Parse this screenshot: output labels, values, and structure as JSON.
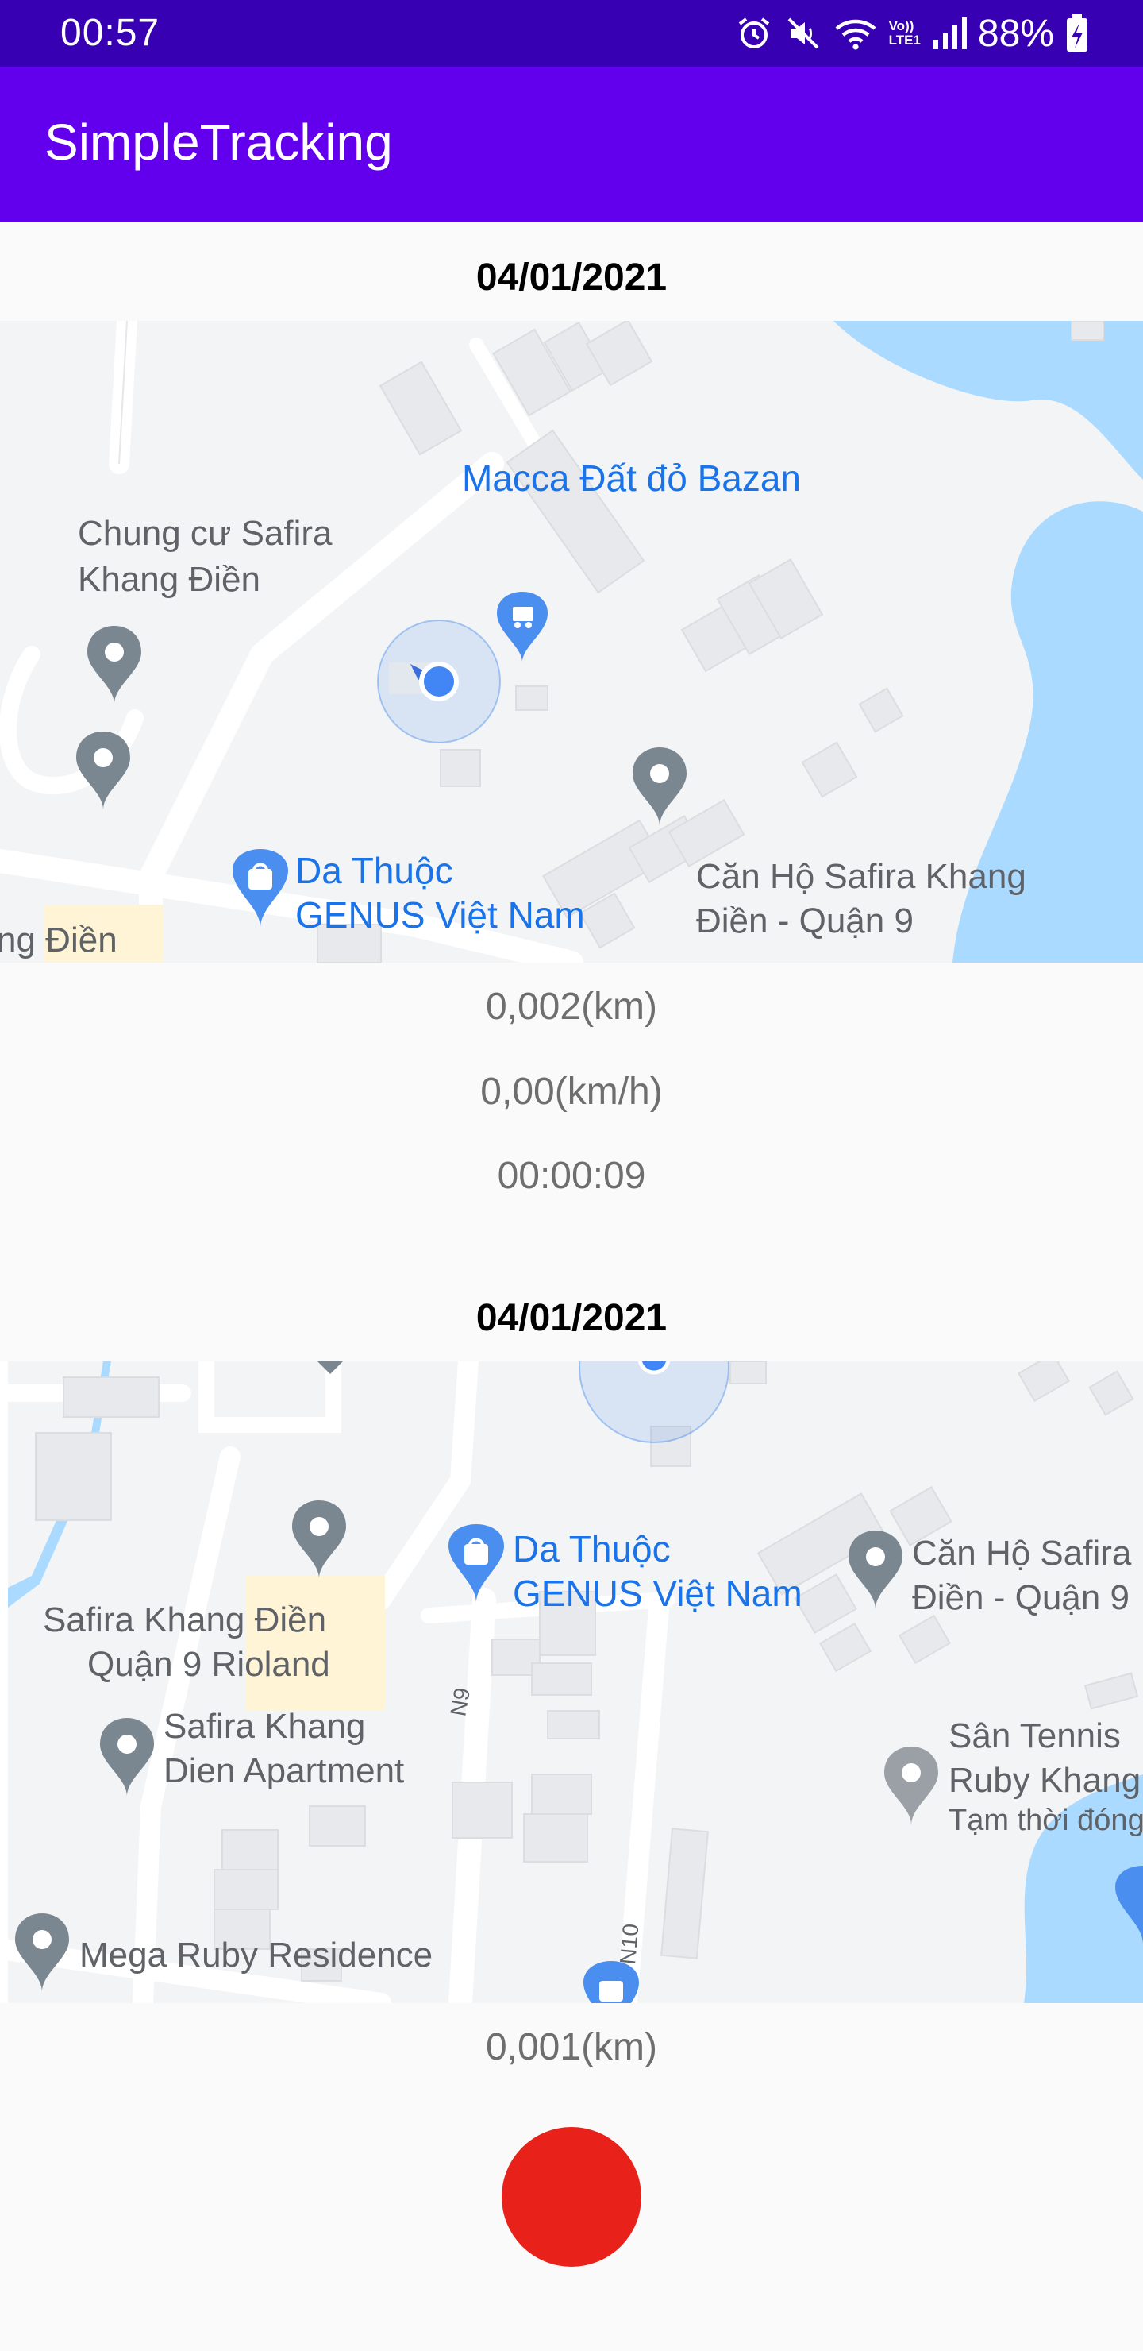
{
  "status_bar": {
    "time": "00:57",
    "battery": "88%",
    "icons": [
      "alarm-icon",
      "mute-icon",
      "wifi-icon",
      "volte-icon",
      "signal-icon",
      "battery-charging-icon"
    ],
    "volte_line1": "Vo))",
    "volte_line2": "LTE1"
  },
  "app_bar": {
    "title": "SimpleTracking"
  },
  "entries": [
    {
      "date": "04/01/2021",
      "distance": "0,002(km)",
      "speed": "0,00(km/h)",
      "duration": "00:00:09",
      "map_labels": {
        "macca": "Macca Đất đỏ Bazan",
        "chungcu_1": "Chung cư Safira",
        "chungcu_2": "Khang Điền",
        "dathuoc_1": "Da Thuộc",
        "dathuoc_2": "GENUS Việt Nam",
        "canho_1": "Căn Hộ Safira Khang",
        "canho_2": "Điền - Quận 9",
        "edge": "ng Điền"
      }
    },
    {
      "date": "04/01/2021",
      "distance": "0,001(km)",
      "map_labels": {
        "dathuoc_1": "Da Thuộc",
        "dathuoc_2": "GENUS Việt Nam",
        "canho_1": "Căn Hộ Safira",
        "canho_2": "Điền - Quận 9",
        "rioland_1": "Safira Khang Điền",
        "rioland_2": "Quận 9 Rioland",
        "apartment_1": "Safira Khang",
        "apartment_2": "Dien Apartment",
        "tennis_1": "Sân Tennis",
        "tennis_2": "Ruby Khang",
        "tennis_3": "Tạm thời đóng",
        "megaruby": "Mega Ruby Residence",
        "road_n9": "N9",
        "road_n10": "N10"
      }
    }
  ],
  "colors": {
    "status_bar": "#3700b3",
    "app_bar": "#6200ee",
    "record_button": "#e8221b",
    "water": "#aadaff",
    "poi_blue": "#1a73e8"
  }
}
